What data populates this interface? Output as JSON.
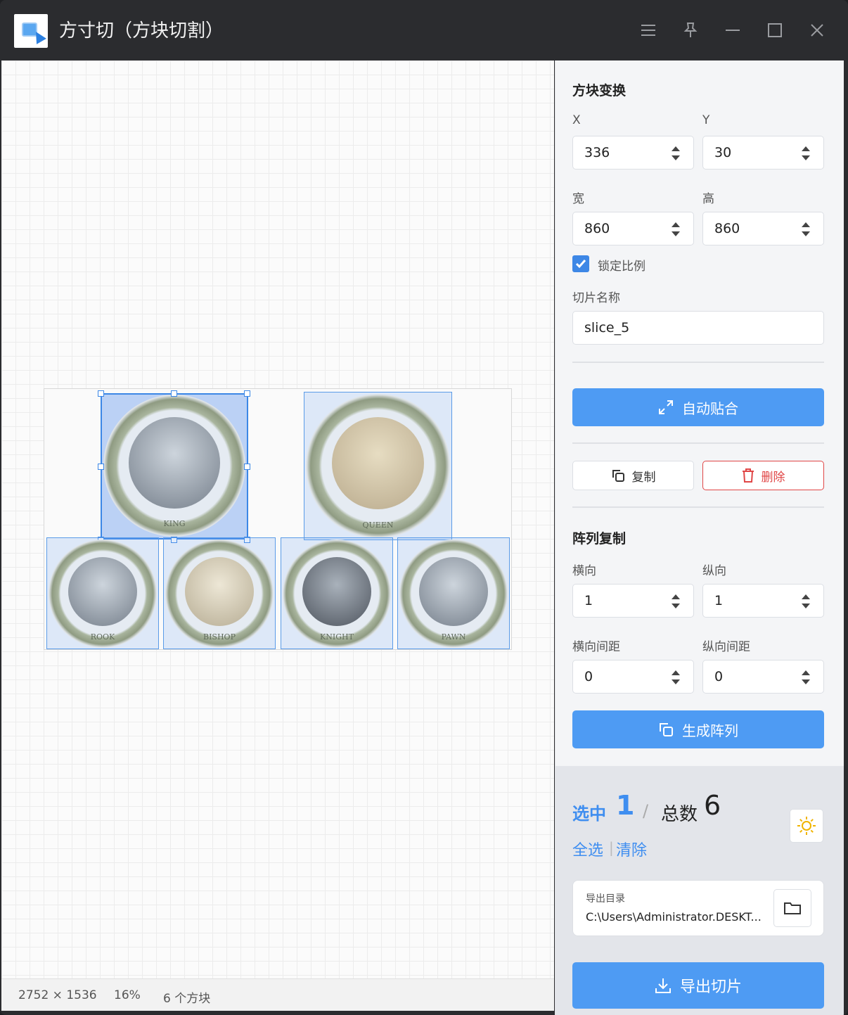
{
  "app": {
    "title": "方寸切（方块切割）"
  },
  "canvas": {
    "status": {
      "dimensions": "2752 × 1536",
      "zoom": "16%",
      "block_count": "6 个方块"
    },
    "slices": [
      {
        "label": "KING",
        "selected": true
      },
      {
        "label": "QUEEN",
        "selected": false
      },
      {
        "label": "ROOK",
        "selected": false
      },
      {
        "label": "BISHOP",
        "selected": false
      },
      {
        "label": "KNIGHT",
        "selected": false
      },
      {
        "label": "PAWN",
        "selected": false
      }
    ]
  },
  "transform": {
    "heading": "方块变换",
    "x_label": "X",
    "y_label": "Y",
    "x_value": "336",
    "y_value": "30",
    "w_label": "宽",
    "h_label": "高",
    "w_value": "860",
    "h_value": "860",
    "lock_ratio_label": "锁定比例",
    "lock_ratio_checked": true,
    "slice_name_label": "切片名称",
    "slice_name_value": "slice_5",
    "auto_fit_label": "自动贴合",
    "copy_label": "复制",
    "delete_label": "删除"
  },
  "array": {
    "heading": "阵列复制",
    "h_label": "横向",
    "v_label": "纵向",
    "h_value": "1",
    "v_value": "1",
    "h_gap_label": "横向间距",
    "v_gap_label": "纵向间距",
    "h_gap_value": "0",
    "v_gap_value": "0",
    "generate_label": "生成阵列"
  },
  "summary": {
    "selected_label": "选中",
    "selected_count": "1",
    "divider": "/",
    "total_label": "总数",
    "total_count": "6",
    "select_all": "全选",
    "clear": "清除",
    "export_dir_label": "导出目录",
    "export_dir_value": "C:\\Users\\Administrator.DESKT...",
    "export_label": "导出切片"
  },
  "colors": {
    "accent": "#4e9bf3",
    "danger": "#e04646",
    "selection": "#3c87e6"
  }
}
